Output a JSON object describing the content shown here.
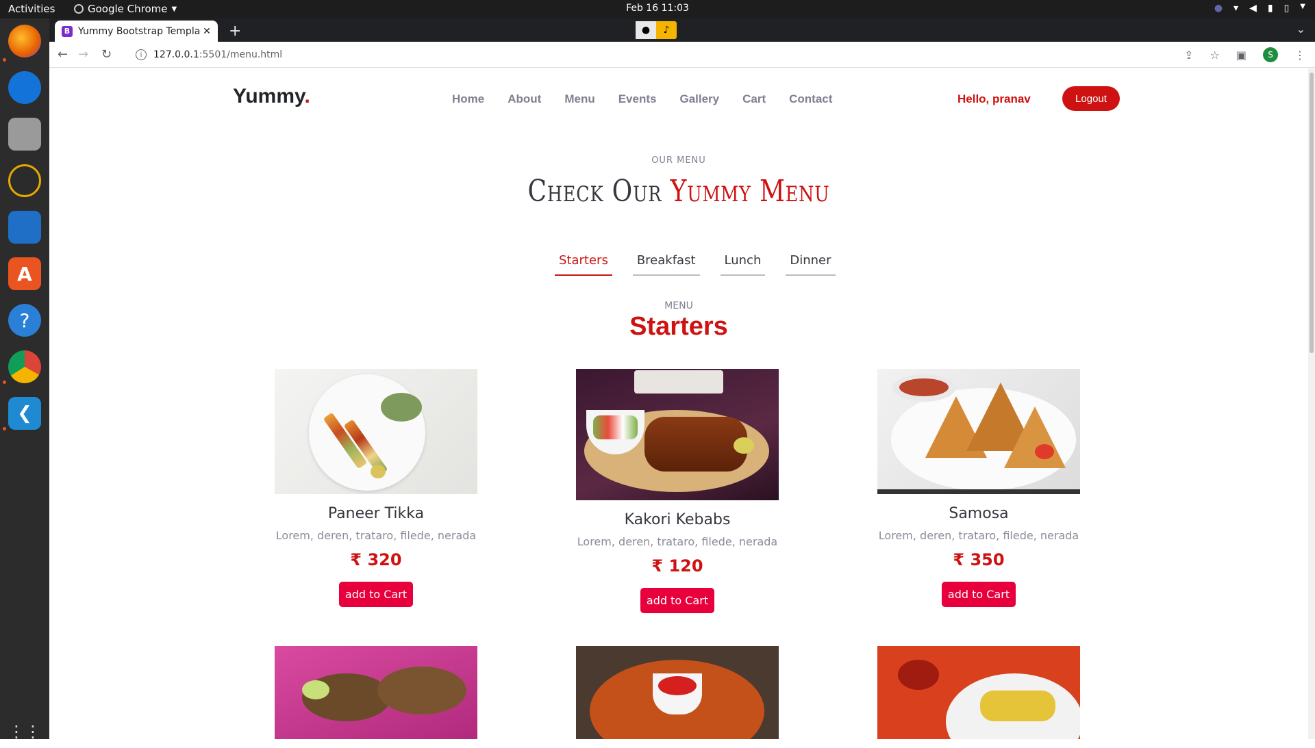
{
  "os": {
    "activities": "Activities",
    "app_name": "Google Chrome",
    "clock": "Feb 16  11:03"
  },
  "browser": {
    "tab_title": "Yummy Bootstrap Template",
    "url_host": "127.0.0.1",
    "url_path": ":5501/menu.html",
    "profile_initial": "S"
  },
  "site": {
    "logo": "Yummy",
    "logo_dot": ".",
    "nav": [
      "Home",
      "About",
      "Menu",
      "Events",
      "Gallery",
      "Cart",
      "Contact"
    ],
    "greeting": "Hello, pranav",
    "logout": "Logout"
  },
  "section": {
    "eyebrow": "OUR MENU",
    "title_start": "Check Our",
    "title_accent": "Yummy Menu",
    "tabs": [
      "Starters",
      "Breakfast",
      "Lunch",
      "Dinner"
    ],
    "active_tab": "Starters",
    "menu_label": "MENU",
    "menu_title": "Starters"
  },
  "items": [
    {
      "name": "Paneer Tikka",
      "desc": "Lorem, deren, trataro, filede, nerada",
      "price": "₹ 320",
      "button": "add to Cart"
    },
    {
      "name": "Kakori Kebabs",
      "desc": "Lorem, deren, trataro, filede, nerada",
      "price": "₹ 120",
      "button": "add to Cart"
    },
    {
      "name": "Samosa",
      "desc": "Lorem, deren, trataro, filede, nerada",
      "price": "₹ 350",
      "button": "add to Cart"
    }
  ],
  "colors": {
    "accent": "#ce1212",
    "button": "#e8003d"
  }
}
